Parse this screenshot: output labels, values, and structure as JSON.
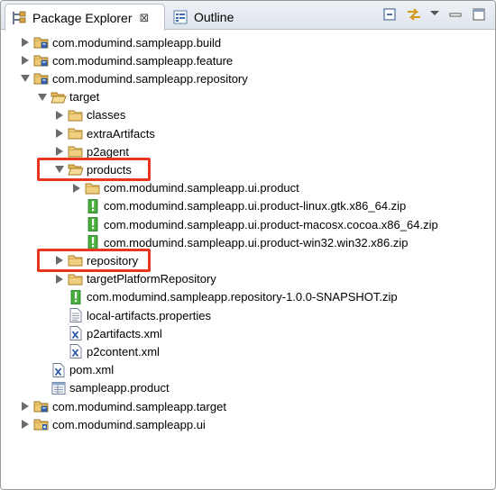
{
  "tabs": [
    {
      "label": "Package Explorer",
      "icon": "package-explorer-icon",
      "close": "⊠",
      "active": true
    },
    {
      "label": "Outline",
      "icon": "outline-icon",
      "active": false
    }
  ],
  "toolbar": {
    "collapse_icon": "collapse-all-icon",
    "link_icon": "link-with-editor-icon",
    "menu_icon": "view-menu-icon",
    "minimize_icon": "minimize-icon",
    "maximize_icon": "maximize-icon"
  },
  "tree": [
    {
      "label": "com.modumind.sampleapp.build",
      "depth": 0,
      "expander": "collapsed",
      "icon": "project"
    },
    {
      "label": "com.modumind.sampleapp.feature",
      "depth": 0,
      "expander": "collapsed",
      "icon": "project"
    },
    {
      "label": "com.modumind.sampleapp.repository",
      "depth": 0,
      "expander": "expanded",
      "icon": "project"
    },
    {
      "label": "target",
      "depth": 1,
      "expander": "expanded",
      "icon": "folder-open"
    },
    {
      "label": "classes",
      "depth": 2,
      "expander": "collapsed",
      "icon": "folder"
    },
    {
      "label": "extraArtifacts",
      "depth": 2,
      "expander": "collapsed",
      "icon": "folder"
    },
    {
      "label": "p2agent",
      "depth": 2,
      "expander": "collapsed",
      "icon": "folder"
    },
    {
      "label": "products",
      "depth": 2,
      "expander": "expanded",
      "icon": "folder-open",
      "highlighted": true
    },
    {
      "label": "com.modumind.sampleapp.ui.product",
      "depth": 3,
      "expander": "collapsed",
      "icon": "folder"
    },
    {
      "label": "com.modumind.sampleapp.ui.product-linux.gtk.x86_64.zip",
      "depth": 3,
      "expander": "none",
      "icon": "zip"
    },
    {
      "label": "com.modumind.sampleapp.ui.product-macosx.cocoa.x86_64.zip",
      "depth": 3,
      "expander": "none",
      "icon": "zip"
    },
    {
      "label": "com.modumind.sampleapp.ui.product-win32.win32.x86.zip",
      "depth": 3,
      "expander": "none",
      "icon": "zip"
    },
    {
      "label": "repository",
      "depth": 2,
      "expander": "collapsed",
      "icon": "folder",
      "highlighted": true
    },
    {
      "label": "targetPlatformRepository",
      "depth": 2,
      "expander": "collapsed",
      "icon": "folder"
    },
    {
      "label": "com.modumind.sampleapp.repository-1.0.0-SNAPSHOT.zip",
      "depth": 2,
      "expander": "none",
      "icon": "zip"
    },
    {
      "label": "local-artifacts.properties",
      "depth": 2,
      "expander": "none",
      "icon": "properties"
    },
    {
      "label": "p2artifacts.xml",
      "depth": 2,
      "expander": "none",
      "icon": "xml"
    },
    {
      "label": "p2content.xml",
      "depth": 2,
      "expander": "none",
      "icon": "xml"
    },
    {
      "label": "pom.xml",
      "depth": 1,
      "expander": "none",
      "icon": "xml"
    },
    {
      "label": "sampleapp.product",
      "depth": 1,
      "expander": "none",
      "icon": "product"
    },
    {
      "label": "com.modumind.sampleapp.target",
      "depth": 0,
      "expander": "collapsed",
      "icon": "project"
    },
    {
      "label": "com.modumind.sampleapp.ui",
      "depth": 0,
      "expander": "collapsed",
      "icon": "plugin-project"
    }
  ],
  "colors": {
    "highlight_border": "#e8361f",
    "folder": "#e8c46a",
    "zip_green": "#3aa635",
    "triangle": "#6b6b6b"
  }
}
